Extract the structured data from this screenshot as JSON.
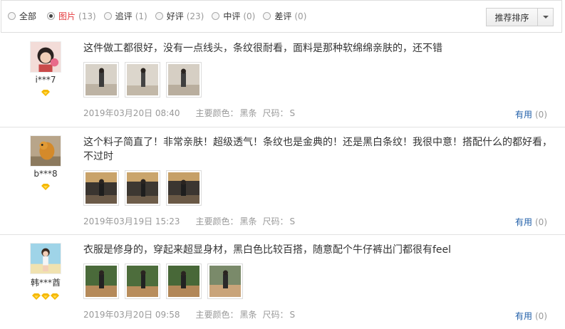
{
  "filters": [
    {
      "label": "全部",
      "count": "",
      "selected": false
    },
    {
      "label": "图片",
      "count": "(13)",
      "selected": true
    },
    {
      "label": "追评",
      "count": "(1)",
      "selected": false
    },
    {
      "label": "好评",
      "count": "(23)",
      "selected": false
    },
    {
      "label": "中评",
      "count": "(0)",
      "selected": false
    },
    {
      "label": "差评",
      "count": "(0)",
      "selected": false
    }
  ],
  "sort": {
    "label": "推荐排序"
  },
  "colors": {
    "accent_red": "#e4393c",
    "link_blue": "#1f5ea8",
    "muted": "#999999",
    "badge_gold": "#f5b800"
  },
  "reviews": [
    {
      "user": {
        "name": "i***7",
        "avatar_icon": "girl-avatar-icon",
        "badges": 1
      },
      "text": "这件做工都很好，没有一点线头，条纹很耐看，面料是那种软绵绵亲肤的，还不错",
      "photo_count": 3,
      "date": "2019年03月20日 08:40",
      "color_label": "主要颜色：",
      "color_value": "黑条",
      "size_label": "尺码：",
      "size_value": "S",
      "helpful_label": "有用",
      "helpful_count": "(0)"
    },
    {
      "user": {
        "name": "b***8",
        "avatar_icon": "dog-avatar-icon",
        "badges": 1
      },
      "text": "这个料子简直了！非常亲肤！超级透气！条纹也是金典的！还是黑白条纹！我很中意！搭配什么的都好看，不过时",
      "photo_count": 3,
      "date": "2019年03月19日 15:23",
      "color_label": "主要颜色：",
      "color_value": "黑条",
      "size_label": "尺码：",
      "size_value": "S",
      "helpful_label": "有用",
      "helpful_count": "(0)"
    },
    {
      "user": {
        "name": "韩***酋",
        "avatar_icon": "girl-avatar-icon",
        "badges": 3
      },
      "text": "衣服是修身的，穿起来超显身材，黑白色比较百搭，随意配个牛仔裤出门都很有feel",
      "photo_count": 4,
      "date": "2019年03月20日 09:58",
      "color_label": "主要颜色：",
      "color_value": "黑条",
      "size_label": "尺码：",
      "size_value": "S",
      "helpful_label": "有用",
      "helpful_count": "(0)"
    }
  ]
}
